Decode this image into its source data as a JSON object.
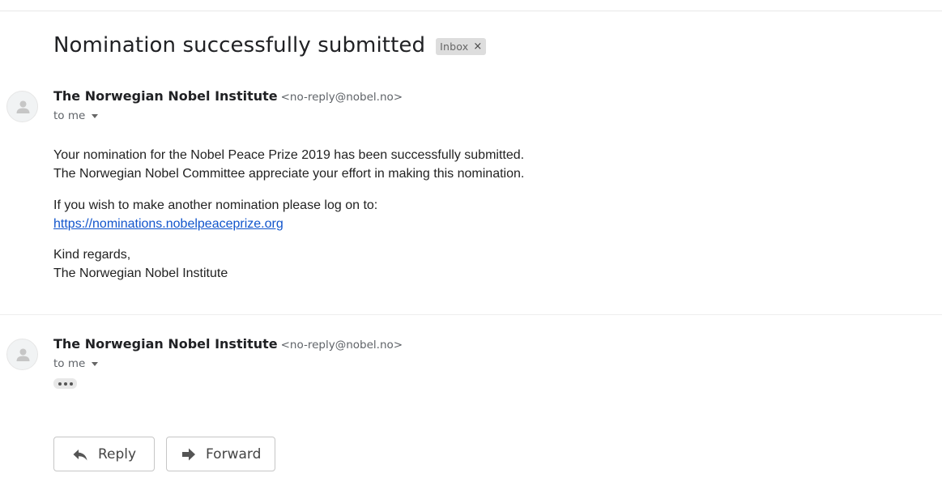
{
  "email": {
    "subject": "Nomination successfully submitted",
    "label": {
      "text": "Inbox",
      "close_glyph": "×"
    }
  },
  "messages": [
    {
      "sender_name": "The Norwegian Nobel Institute",
      "sender_email": "<no-reply@nobel.no>",
      "recipient": "to me",
      "body": {
        "para1_line1": "Your nomination for the Nobel Peace Prize 2019 has been successfully submitted.",
        "para1_line2": "The Norwegian Nobel Committee appreciate your effort in making this nomination.",
        "para2_line1": "If you wish to make another nomination please log on to:",
        "link": "https://nominations.nobelpeaceprize.org",
        "para3_line1": "Kind regards,",
        "para3_line2": "The Norwegian Nobel Institute"
      }
    },
    {
      "sender_name": "The Norwegian Nobel Institute",
      "sender_email": "<no-reply@nobel.no>",
      "recipient": "to me",
      "collapsed": true
    }
  ],
  "actions": {
    "reply_label": "Reply",
    "forward_label": "Forward"
  },
  "icons": {
    "avatar": "default-avatar-icon",
    "recipient_caret": "chevron-down-icon",
    "show_trimmed": "ellipsis-icon",
    "reply": "reply-arrow-icon",
    "forward": "forward-arrow-icon"
  },
  "colors": {
    "link": "#1155cc",
    "label_chip_bg": "#dddddd",
    "avatar_bg": "#f1f3f4"
  }
}
